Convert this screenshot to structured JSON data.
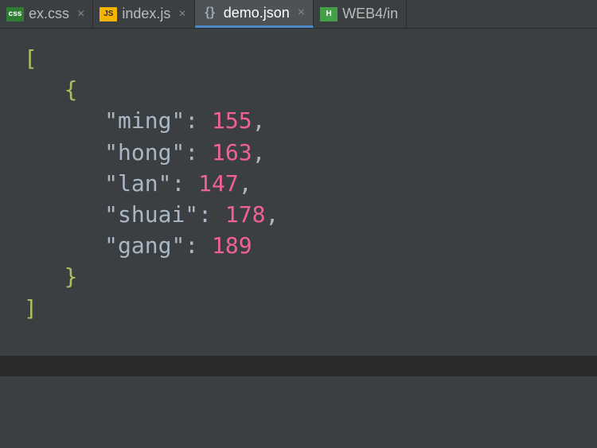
{
  "tabs": [
    {
      "label": "ex.css",
      "iconText": "css",
      "iconClass": "icon-css"
    },
    {
      "label": "index.js",
      "iconText": "JS",
      "iconClass": "icon-js"
    },
    {
      "label": "demo.json",
      "iconText": "{}",
      "iconClass": "icon-json",
      "active": true
    },
    {
      "label": "WEB4/in",
      "iconText": "H",
      "iconClass": "icon-html"
    }
  ],
  "code": {
    "openBracket": "[",
    "openBrace": "{",
    "entries": [
      {
        "key": "\"ming\"",
        "value": "155",
        "comma": ","
      },
      {
        "key": "\"hong\"",
        "value": "163",
        "comma": ","
      },
      {
        "key": "\"lan\"",
        "value": "147",
        "comma": ","
      },
      {
        "key": "\"shuai\"",
        "value": "178",
        "comma": ","
      },
      {
        "key": "\"gang\"",
        "value": "189",
        "comma": ""
      }
    ],
    "closeBrace": "}",
    "closeBracket": "]",
    "colon": ": "
  },
  "closeGlyph": "×"
}
